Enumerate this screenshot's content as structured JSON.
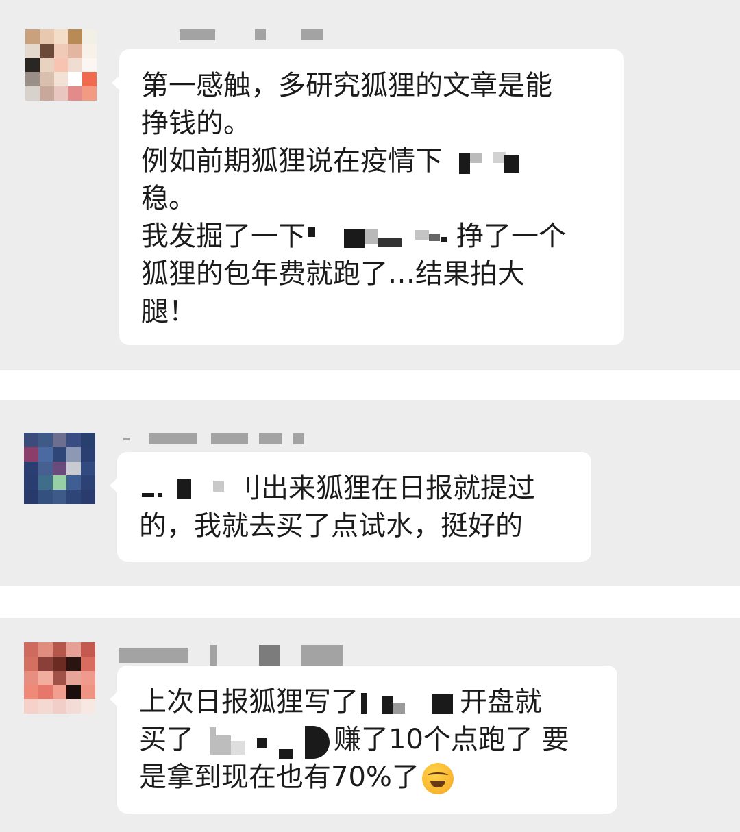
{
  "chat": {
    "messages": [
      {
        "avatar_colors": [
          "#c9a27d",
          "#e8c9b0",
          "#f3dcc8",
          "#b88a55",
          "#f2efe6",
          "#e4d9cc",
          "#6b4a3a",
          "#f0c9b7",
          "#e2b6a0",
          "#f8f1ea",
          "#2a2623",
          "#e8d2c0",
          "#f6c4b0",
          "#eeddd0",
          "#fbf6f2",
          "#9a8e88",
          "#d9bfae",
          "#f2e2d6",
          "#ffffff",
          "#ef6a4f",
          "#d8d2cc",
          "#c9a89c",
          "#eac6c0",
          "#e38a8a",
          "#f29a82"
        ],
        "lines": [
          "第一感触，多研究狐狸的文章是能",
          "挣钱的。",
          "例如前期狐狸说在疫情下",
          "稳。",
          "我发掘了一下",
          "挣了一个",
          "狐狸的包年费就跑了…结果拍大",
          "腿！"
        ]
      },
      {
        "avatar_colors": [
          "#3b4c7a",
          "#3e5a86",
          "#6d6f8f",
          "#3a4d83",
          "#27406e",
          "#8b3e6a",
          "#4b6aa2",
          "#2f4679",
          "#8c98b4",
          "#2c3f73",
          "#2b3e71",
          "#466092",
          "#6b4a7c",
          "#c9cbd3",
          "#314a80",
          "#2a3d70",
          "#3f6e8a",
          "#98d0a6",
          "#3f5e94",
          "#2d4274",
          "#273a6b",
          "#34507e",
          "#3d5a88",
          "#2e4577",
          "#2a3c6d"
        ],
        "lines": [
          "刂出来狐狸在日报就提过",
          "的，我就去买了点试水，挺好的"
        ]
      },
      {
        "avatar_colors": [
          "#cf6a5e",
          "#e08c7e",
          "#b6574c",
          "#e7a096",
          "#c45a4f",
          "#d4705f",
          "#8a4038",
          "#6b2a22",
          "#2a1411",
          "#d86c5e",
          "#e78e80",
          "#f1ad9e",
          "#a15248",
          "#e7a599",
          "#ef9a8c",
          "#f08a78",
          "#e7776a",
          "#f29f90",
          "#1b0e0c",
          "#ef9383",
          "#f5d1ca",
          "#f4d9d2",
          "#f1cfc8",
          "#f4dcd6",
          "#f8e8e4"
        ],
        "lines": [
          "上次日报狐狸写了",
          "开盘就",
          "买了",
          "赚了10个点跑了 要",
          "是拿到现在也有70%了"
        ],
        "emoji": "face-with-tears-of-joy-icon"
      }
    ]
  }
}
